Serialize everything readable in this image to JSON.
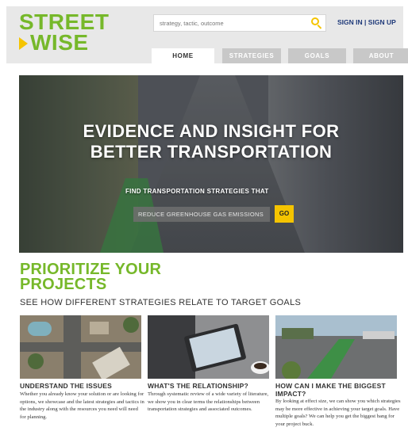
{
  "brand": {
    "line1": "STREET",
    "line2": "WISE",
    "green": "#76b82a",
    "yellow": "#f5c400"
  },
  "search": {
    "placeholder": "strategy, tactic, outcome",
    "icon": "search-icon"
  },
  "auth": {
    "sign_in": "SIGN IN",
    "separator": "|",
    "sign_up": "SIGN UP"
  },
  "nav": {
    "tabs": [
      {
        "label": "HOME",
        "active": true
      },
      {
        "label": "STRATEGIES",
        "active": false
      },
      {
        "label": "GOALS",
        "active": false
      },
      {
        "label": "ABOUT",
        "active": false
      }
    ]
  },
  "hero": {
    "title_line1": "EVIDENCE AND INSIGHT FOR",
    "title_line2": "BETTER TRANSPORTATION",
    "prompt": "FIND TRANSPORTATION STRATEGIES THAT",
    "select_value": "REDUCE GREENHOUSE GAS EMISSIONS",
    "go_label": "GO"
  },
  "prioritize": {
    "title_line1": "PRIORITIZE YOUR",
    "title_line2": "PROJECTS",
    "subtitle": "SEE HOW DIFFERENT STRATEGIES RELATE TO TARGET GOALS"
  },
  "cards": [
    {
      "title": "UNDERSTAND THE ISSUES",
      "body": "Whether you already know your solution or are looking for options, we showcase and the latest strategies and tactics in the industry along with the resources you need will need for planning."
    },
    {
      "title": "WHAT'S THE RELATIONSHIP?",
      "body": "Through systematic review of a wide variety of literature, we show you in clear terms the relationships between transportation strategies and associated outcomes."
    },
    {
      "title_line1": "HOW CAN I MAKE THE BIGGEST",
      "title_line2": "IMPACT?",
      "body": "By looking at effect size, we can show you which strategies may be more effective in achieving your target goals. Have multiple goals? We can help you get the biggest bang for your project buck."
    }
  ]
}
